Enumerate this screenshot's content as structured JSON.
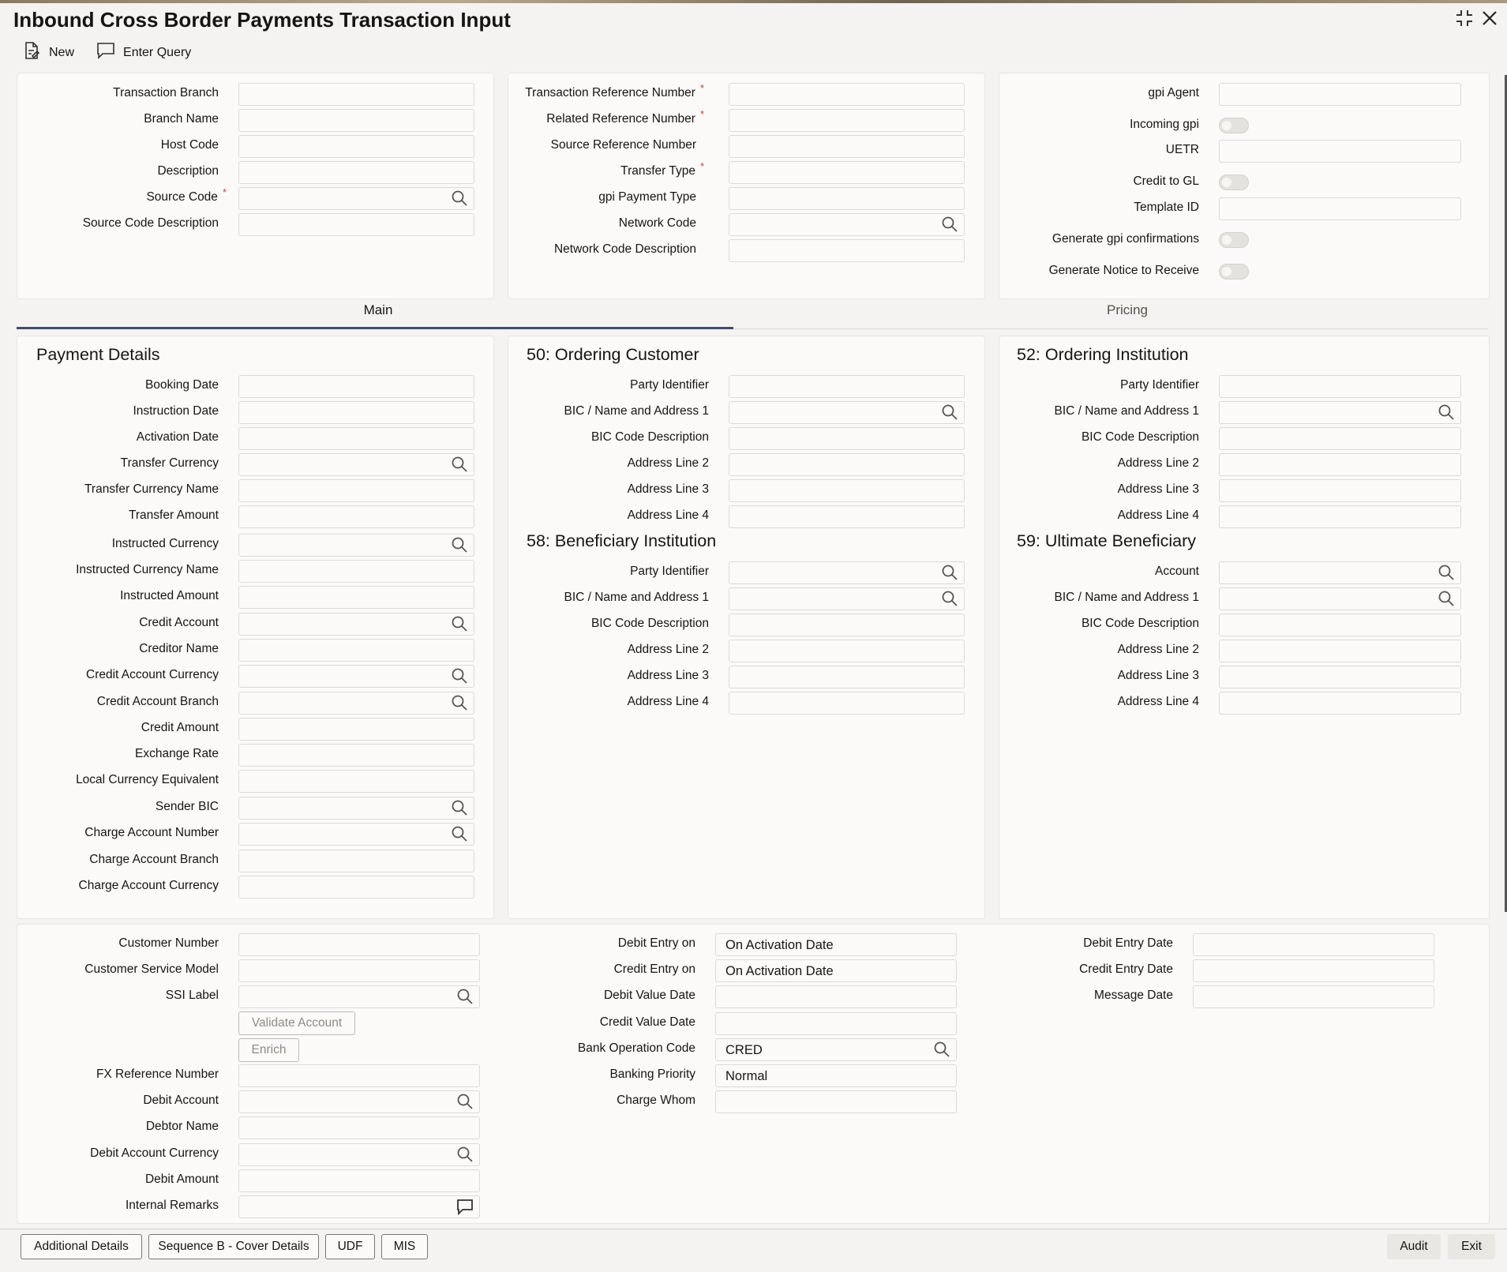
{
  "window": {
    "title": "Inbound Cross Border Payments Transaction Input"
  },
  "toolbar": {
    "new_label": "New",
    "enter_query_label": "Enter Query"
  },
  "header_left": {
    "fields": [
      {
        "label": "Transaction Branch",
        "value": "",
        "required": false,
        "search": false
      },
      {
        "label": "Branch Name",
        "value": "",
        "required": false,
        "search": false
      },
      {
        "label": "Host Code",
        "value": "",
        "required": false,
        "search": false
      },
      {
        "label": "Description",
        "value": "",
        "required": false,
        "search": false
      },
      {
        "label": "Source Code",
        "value": "",
        "required": true,
        "search": true
      },
      {
        "label": "Source Code Description",
        "value": "",
        "required": false,
        "search": false
      }
    ]
  },
  "header_mid": {
    "fields": [
      {
        "label": "Transaction Reference Number",
        "value": "",
        "required": true,
        "search": false
      },
      {
        "label": "Related Reference Number",
        "value": "",
        "required": true,
        "search": false
      },
      {
        "label": "Source Reference Number",
        "value": "",
        "required": false,
        "search": false
      },
      {
        "label": "Transfer Type",
        "value": "",
        "required": true,
        "search": false
      },
      {
        "label": "gpi Payment Type",
        "value": "",
        "required": false,
        "search": false
      },
      {
        "label": "Network Code",
        "value": "",
        "required": false,
        "search": true
      },
      {
        "label": "Network Code Description",
        "value": "",
        "required": false,
        "search": false
      }
    ]
  },
  "header_right": {
    "fields": [
      {
        "label": "gpi Agent",
        "type": "input",
        "value": ""
      },
      {
        "label": "Incoming gpi",
        "type": "toggle",
        "value": "off"
      },
      {
        "label": "UETR",
        "type": "input",
        "value": ""
      },
      {
        "label": "Credit to GL",
        "type": "toggle",
        "value": "off"
      },
      {
        "label": "Template ID",
        "type": "input",
        "value": ""
      },
      {
        "label": "Generate gpi confirmations",
        "type": "toggle",
        "value": "off"
      },
      {
        "label": "Generate Notice to Receive",
        "type": "toggle",
        "value": "off"
      }
    ]
  },
  "tabs": [
    {
      "label": "Main",
      "active": true
    },
    {
      "label": "Pricing",
      "active": false
    }
  ],
  "payment_details": {
    "title": "Payment Details",
    "fields": [
      {
        "label": "Booking Date",
        "value": "",
        "search": false
      },
      {
        "label": "Instruction Date",
        "value": "",
        "search": false
      },
      {
        "label": "Activation Date",
        "value": "",
        "search": false
      },
      {
        "label": "Transfer Currency",
        "value": "",
        "search": true
      },
      {
        "label": "Transfer Currency Name",
        "value": "",
        "search": false
      },
      {
        "label": "Transfer Amount",
        "value": "",
        "search": false
      },
      {
        "label": "Instructed Currency",
        "value": "",
        "search": true
      },
      {
        "label": "Instructed Currency Name",
        "value": "",
        "search": false
      },
      {
        "label": "Instructed Amount",
        "value": "",
        "search": false
      },
      {
        "label": "Credit Account",
        "value": "",
        "search": true
      },
      {
        "label": "Creditor Name",
        "value": "",
        "search": false
      },
      {
        "label": "Credit Account Currency",
        "value": "",
        "search": true
      },
      {
        "label": "Credit Account Branch",
        "value": "",
        "search": true
      },
      {
        "label": "Credit Amount",
        "value": "",
        "search": false
      },
      {
        "label": "Exchange Rate",
        "value": "",
        "search": false
      },
      {
        "label": "Local Currency Equivalent",
        "value": "",
        "search": false
      },
      {
        "label": "Sender BIC",
        "value": "",
        "search": true
      },
      {
        "label": "Charge Account Number",
        "value": "",
        "search": true
      },
      {
        "label": "Charge Account Branch",
        "value": "",
        "search": false
      },
      {
        "label": "Charge Account Currency",
        "value": "",
        "search": false
      }
    ]
  },
  "ordering_customer": {
    "title": "50: Ordering Customer",
    "fields": [
      {
        "label": "Party Identifier",
        "value": "",
        "search": false
      },
      {
        "label": "BIC / Name and Address 1",
        "value": "",
        "search": true
      },
      {
        "label": "BIC Code Description",
        "value": "",
        "search": false
      },
      {
        "label": "Address Line 2",
        "value": "",
        "search": false
      },
      {
        "label": "Address Line 3",
        "value": "",
        "search": false
      },
      {
        "label": "Address Line 4",
        "value": "",
        "search": false
      }
    ]
  },
  "beneficiary_institution": {
    "title": "58: Beneficiary Institution",
    "fields": [
      {
        "label": "Party Identifier",
        "value": "",
        "search": true
      },
      {
        "label": "BIC / Name and Address 1",
        "value": "",
        "search": true
      },
      {
        "label": "BIC Code Description",
        "value": "",
        "search": false
      },
      {
        "label": "Address Line 2",
        "value": "",
        "search": false
      },
      {
        "label": "Address Line 3",
        "value": "",
        "search": false
      },
      {
        "label": "Address Line 4",
        "value": "",
        "search": false
      }
    ]
  },
  "ordering_institution": {
    "title": "52: Ordering Institution",
    "fields": [
      {
        "label": "Party Identifier",
        "value": "",
        "search": false
      },
      {
        "label": "BIC / Name and Address 1",
        "value": "",
        "search": true
      },
      {
        "label": "BIC Code Description",
        "value": "",
        "search": false
      },
      {
        "label": "Address Line 2",
        "value": "",
        "search": false
      },
      {
        "label": "Address Line 3",
        "value": "",
        "search": false
      },
      {
        "label": "Address Line 4",
        "value": "",
        "search": false
      }
    ]
  },
  "ultimate_beneficiary": {
    "title": "59: Ultimate Beneficiary",
    "fields": [
      {
        "label": "Account",
        "value": "",
        "search": true
      },
      {
        "label": "BIC / Name and Address 1",
        "value": "",
        "search": true
      },
      {
        "label": "BIC Code Description",
        "value": "",
        "search": false
      },
      {
        "label": "Address Line 2",
        "value": "",
        "search": false
      },
      {
        "label": "Address Line 3",
        "value": "",
        "search": false
      },
      {
        "label": "Address Line 4",
        "value": "",
        "search": false
      }
    ]
  },
  "bottom_left": {
    "fields_top": [
      {
        "label": "Customer Number",
        "value": "",
        "search": false
      },
      {
        "label": "Customer Service Model",
        "value": "",
        "search": false
      },
      {
        "label": "SSI Label",
        "value": "",
        "search": true
      }
    ],
    "validate_account_label": "Validate Account",
    "enrich_label": "Enrich",
    "fields_bottom": [
      {
        "label": "FX Reference Number",
        "value": "",
        "search": false
      },
      {
        "label": "Debit Account",
        "value": "",
        "search": true
      },
      {
        "label": "Debtor Name",
        "value": "",
        "search": false
      },
      {
        "label": "Debit Account Currency",
        "value": "",
        "search": true
      },
      {
        "label": "Debit Amount",
        "value": "",
        "search": false
      },
      {
        "label": "Internal Remarks",
        "value": "",
        "search": false,
        "comment": true
      }
    ]
  },
  "bottom_mid": {
    "fields": [
      {
        "label": "Debit Entry on",
        "value": "On Activation Date",
        "search": false
      },
      {
        "label": "Credit Entry on",
        "value": "On Activation Date",
        "search": false
      },
      {
        "label": "Debit Value Date",
        "value": "",
        "search": false
      },
      {
        "label": "Credit Value Date",
        "value": "",
        "search": false
      },
      {
        "label": "Bank Operation Code",
        "value": "CRED",
        "search": true
      },
      {
        "label": "Banking Priority",
        "value": "Normal",
        "search": false
      },
      {
        "label": "Charge Whom",
        "value": "",
        "search": false
      }
    ]
  },
  "bottom_right": {
    "fields": [
      {
        "label": "Debit Entry Date",
        "value": ""
      },
      {
        "label": "Credit Entry Date",
        "value": ""
      },
      {
        "label": "Message Date",
        "value": ""
      }
    ]
  },
  "footer": {
    "buttons": [
      "Additional Details",
      "Sequence B - Cover Details",
      "UDF",
      "MIS"
    ],
    "audit_label": "Audit",
    "exit_label": "Exit"
  },
  "icons": {
    "new": "new-document-icon",
    "enter_query": "chat-bubble-icon",
    "search": "search-icon",
    "comment": "comment-icon",
    "maximize": "collapse-arrows-icon",
    "close": "close-icon"
  }
}
